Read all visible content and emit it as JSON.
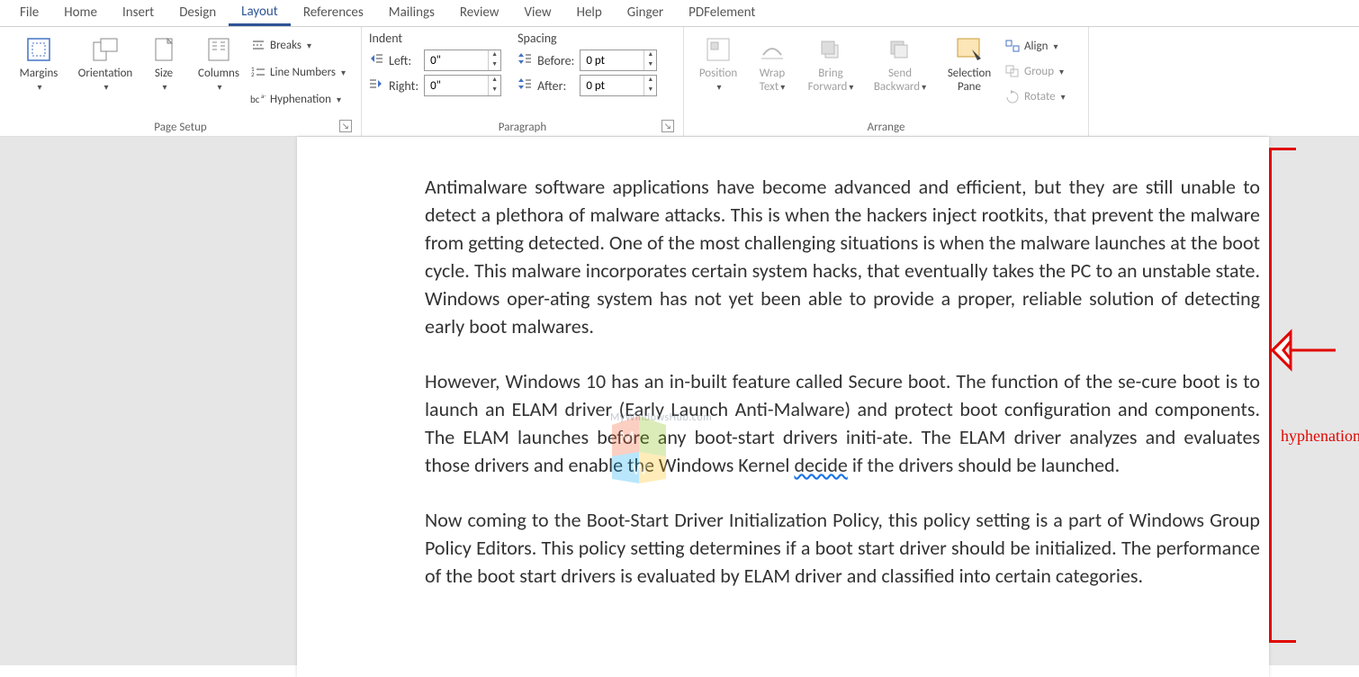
{
  "tabs": {
    "file": "File",
    "home": "Home",
    "insert": "Insert",
    "design": "Design",
    "layout": "Layout",
    "references": "References",
    "mailings": "Mailings",
    "review": "Review",
    "view": "View",
    "help": "Help",
    "ginger": "Ginger",
    "pdfelement": "PDFelement"
  },
  "pagesetup": {
    "label": "Page Setup",
    "margins": "Margins",
    "orientation": "Orientation",
    "size": "Size",
    "columns": "Columns",
    "breaks": "Breaks",
    "linenumbers": "Line Numbers",
    "hyphenation": "Hyphenation"
  },
  "paragraph": {
    "label": "Paragraph",
    "indent_header": "Indent",
    "spacing_header": "Spacing",
    "left_label": "Left:",
    "right_label": "Right:",
    "before_label": "Before:",
    "after_label": "After:",
    "left_value": "0\"",
    "right_value": "0\"",
    "before_value": "0 pt",
    "after_value": "0 pt"
  },
  "arrange": {
    "label": "Arrange",
    "position": "Position",
    "wraptext": "Wrap Text",
    "bringforward": "Bring Forward",
    "sendbackward": "Send Backward",
    "selectionpane": "Selection Pane",
    "align": "Align",
    "group": "Group",
    "rotate": "Rotate"
  },
  "watermark_text": "MyWindowsHub.com",
  "annotation_label": "hyphenation",
  "document": {
    "para1": "Antimalware software applications have become advanced and efficient, but they are still unable to detect a plethora of malware attacks. This is when the hackers inject rootkits, that prevent the malware from getting detected. One of the most challenging situations is when the malware launches at the boot cycle. This malware incorporates certain system hacks, that eventually takes the PC to an unstable state. Windows oper-ating system has not yet been able to provide a proper, reliable solution of detecting early boot malwares.",
    "para2a": "However, Windows 10 has an in-built feature called Secure boot. The function of the se-cure boot is to launch an ELAM driver (Early Launch Anti-Malware) and protect boot configuration and components. The ELAM launches before any boot-start drivers initi-ate. The ELAM driver analyzes and evaluates those drivers and enable the Windows Kernel ",
    "para2b": "decide",
    "para2c": " if the drivers should be launched.",
    "para3": "Now coming to the Boot-Start Driver Initialization Policy, this policy setting is a part of Windows Group Policy Editors. This policy setting determines if a boot start driver should be initialized.  The performance of the boot start drivers is evaluated by ELAM driver and classified into certain categories."
  }
}
